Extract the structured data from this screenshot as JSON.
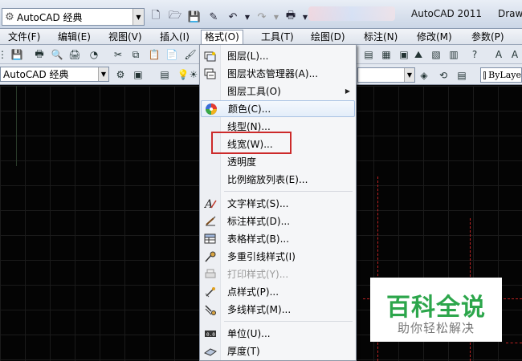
{
  "titlebar": {
    "workspace": "AutoCAD 经典",
    "app_title": "AutoCAD 2011",
    "drawing_title": "Draw"
  },
  "menubar": {
    "items": [
      "文件(F)",
      "编辑(E)",
      "视图(V)",
      "插入(I)",
      "格式(O)",
      "工具(T)",
      "绘图(D)",
      "标注(N)",
      "修改(M)",
      "参数(P)"
    ],
    "active": "格式(O)"
  },
  "toolbar": {
    "workspace_combo": "AutoCAD 经典",
    "linetype_combo": "ByLaye"
  },
  "format_menu": {
    "items": [
      {
        "label": "图层(L)...",
        "icon": "layers-icon",
        "enabled": true
      },
      {
        "label": "图层状态管理器(A)...",
        "icon": "layer-states-icon",
        "enabled": true
      },
      {
        "label": "图层工具(O)",
        "icon": "",
        "enabled": true,
        "submenu": true
      },
      {
        "label": "颜色(C)...",
        "icon": "color-wheel-icon",
        "enabled": true,
        "highlighted": true
      },
      {
        "label": "线型(N)...",
        "icon": "",
        "enabled": true
      },
      {
        "label": "线宽(W)...",
        "icon": "",
        "enabled": true,
        "outlined": true
      },
      {
        "label": "透明度",
        "icon": "",
        "enabled": true
      },
      {
        "label": "比例缩放列表(E)...",
        "icon": "",
        "enabled": true
      },
      {
        "label": "文字样式(S)...",
        "icon": "text-style-icon",
        "enabled": true
      },
      {
        "label": "标注样式(D)...",
        "icon": "dimension-style-icon",
        "enabled": true
      },
      {
        "label": "表格样式(B)...",
        "icon": "table-style-icon",
        "enabled": true
      },
      {
        "label": "多重引线样式(I)",
        "icon": "multileader-style-icon",
        "enabled": true
      },
      {
        "label": "打印样式(Y)...",
        "icon": "plot-style-icon",
        "enabled": false
      },
      {
        "label": "点样式(P)...",
        "icon": "point-style-icon",
        "enabled": true
      },
      {
        "label": "多线样式(M)...",
        "icon": "multiline-style-icon",
        "enabled": true
      },
      {
        "label": "单位(U)...",
        "icon": "units-icon",
        "enabled": true
      },
      {
        "label": "厚度(T)",
        "icon": "thickness-icon",
        "enabled": true
      }
    ]
  },
  "watermark": {
    "title": "百科全说",
    "subtitle": "助你轻松解决"
  },
  "colors": {
    "highlight_outline": "#cc2a2a",
    "watermark_green": "#2ca64b",
    "canvas_background": "#040404"
  }
}
